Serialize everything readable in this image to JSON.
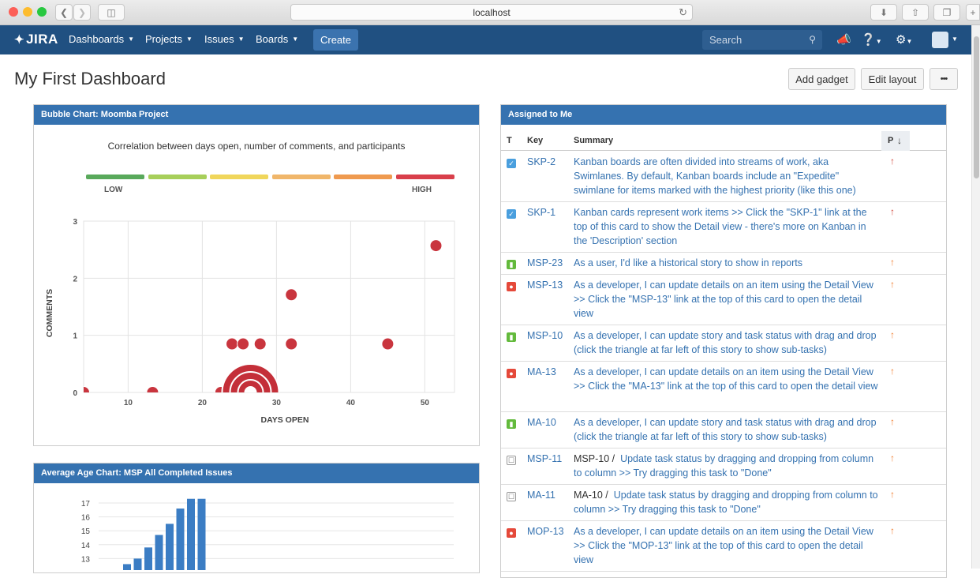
{
  "browser": {
    "url": "localhost"
  },
  "header": {
    "logo": "JIRA",
    "nav": [
      "Dashboards",
      "Projects",
      "Issues",
      "Boards"
    ],
    "create_label": "Create",
    "search_placeholder": "Search"
  },
  "page": {
    "title": "My First Dashboard",
    "add_gadget_label": "Add gadget",
    "edit_layout_label": "Edit layout",
    "more_label": "•••"
  },
  "bubble_gadget": {
    "title": "Bubble Chart: Moomba Project",
    "caption": "Correlation between days open, number of comments, and participants",
    "low_label": "LOW",
    "high_label": "HIGH",
    "scale_colors": [
      "#59a95b",
      "#a7cf5a",
      "#f0d65b",
      "#f0b66a",
      "#ef9a4f",
      "#d93f4b"
    ]
  },
  "age_gadget": {
    "title": "Average Age Chart: MSP All Completed Issues"
  },
  "assigned_gadget": {
    "title": "Assigned to Me",
    "columns": {
      "type": "T",
      "key": "Key",
      "summary": "Summary",
      "priority": "P"
    },
    "rows": [
      {
        "type": "subtask",
        "key": "SKP-2",
        "summary": "Kanban boards are often divided into streams of work, aka Swimlanes. By default, Kanban boards include an \"Expedite\" swimlane for items marked with the highest priority (like this one)",
        "priority": "highest"
      },
      {
        "type": "subtask",
        "key": "SKP-1",
        "summary": "Kanban cards represent work items >> Click the \"SKP-1\" link at the top of this card to show the Detail view - there's more on Kanban in the 'Description' section",
        "priority": "highest"
      },
      {
        "type": "story",
        "key": "MSP-23",
        "summary": "As a user, I'd like a historical story to show in reports",
        "priority": "high"
      },
      {
        "type": "bug",
        "key": "MSP-13",
        "summary": "As a developer, I can update details on an item using the Detail View >> Click the \"MSP-13\" link at the top of this card to open the detail view",
        "priority": "high"
      },
      {
        "type": "story",
        "key": "MSP-10",
        "summary": "As a developer, I can update story and task status with drag and drop (click the triangle at far left of this story to show sub-tasks)",
        "priority": "high"
      },
      {
        "type": "bug",
        "key": "MA-13",
        "summary": "As a developer, I can update details on an item using the Detail View >> Click the \"MA-13\" link at the top of this card to open the detail view",
        "priority": "high"
      },
      {
        "type": "story",
        "key": "MA-10",
        "summary": "As a developer, I can update story and task status with drag and drop (click the triangle at far left of this story to show sub-tasks)",
        "priority": "high"
      },
      {
        "type": "task",
        "key": "MSP-11",
        "parent": "MSP-10 /",
        "summary": "Update task status by dragging and dropping from column to column >> Try dragging this task to \"Done\"",
        "priority": "high"
      },
      {
        "type": "task",
        "key": "MA-11",
        "parent": "MA-10 /",
        "summary": "Update task status by dragging and dropping from column to column >> Try dragging this task to \"Done\"",
        "priority": "high"
      },
      {
        "type": "bug",
        "key": "MOP-13",
        "summary": "As a developer, I can update details on an item using the Detail View >> Click the \"MOP-13\" link at the top of this card to open the detail view",
        "priority": "high"
      }
    ]
  },
  "chart_data": [
    {
      "type": "scatter",
      "title": "Correlation between days open, number of comments, and participants",
      "xlabel": "DAYS OPEN",
      "ylabel": "COMMENTS",
      "xlim": [
        4,
        54
      ],
      "ylim": [
        0,
        3
      ],
      "xticks": [
        10,
        20,
        30,
        40,
        50
      ],
      "yticks": [
        0,
        1,
        2,
        3
      ],
      "grid": true,
      "points": [
        {
          "x": 4,
          "y": 0,
          "size": 1
        },
        {
          "x": 13.3,
          "y": 0,
          "size": 1
        },
        {
          "x": 22.5,
          "y": 0,
          "size": 1
        },
        {
          "x": 26.5,
          "y": 0,
          "size": 4
        },
        {
          "x": 24,
          "y": 0.85,
          "size": 1
        },
        {
          "x": 25.5,
          "y": 0.85,
          "size": 1
        },
        {
          "x": 27.8,
          "y": 0.85,
          "size": 1
        },
        {
          "x": 32,
          "y": 0.85,
          "size": 1
        },
        {
          "x": 32,
          "y": 1.71,
          "size": 1
        },
        {
          "x": 45,
          "y": 0.85,
          "size": 1
        },
        {
          "x": 51.5,
          "y": 2.57,
          "size": 1
        }
      ]
    },
    {
      "type": "bar",
      "title": "Average Age Chart: MSP All Completed Issues",
      "yticks": [
        13,
        14,
        15,
        16,
        17
      ],
      "ylim": [
        12.4,
        17.3
      ],
      "values": [
        12.6,
        13.0,
        13.8,
        14.7,
        15.5,
        16.6,
        17.3,
        17.3
      ]
    }
  ]
}
